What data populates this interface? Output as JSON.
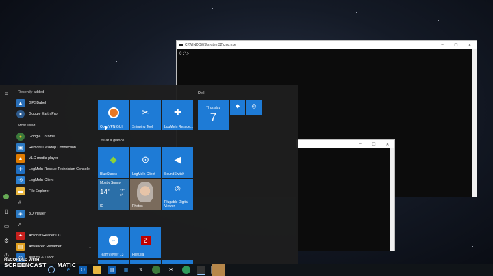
{
  "cmd_main": {
    "title": "C:\\WINDOWS\\system32\\cmd.exe",
    "prompt": "C:\\>"
  },
  "cmd_second": {
    "title": ""
  },
  "start_menu": {
    "sections": {
      "recently_added": "Recently added",
      "most_used": "Most used"
    },
    "recent_apps": [
      {
        "label": "GPSBabel",
        "icon": "gpsbabel-icon",
        "color": "#2a6fb8"
      },
      {
        "label": "Google Earth Pro",
        "icon": "google-earth-icon",
        "color": "#2d5a8c"
      }
    ],
    "most_used": [
      {
        "label": "Google Chrome",
        "icon": "chrome-icon",
        "color": "#3b7a3b"
      },
      {
        "label": "Remote Desktop Connection",
        "icon": "remote-desktop-icon",
        "color": "#2b79c2"
      },
      {
        "label": "VLC media player",
        "icon": "vlc-icon",
        "color": "#e07b00"
      },
      {
        "label": "LogMeIn Rescue Technician Console",
        "icon": "logmein-rescue-icon",
        "color": "#1f6fc2"
      },
      {
        "label": "LogMeIn Client",
        "icon": "logmein-client-icon",
        "color": "#2c7fd0"
      },
      {
        "label": "File Explorer",
        "icon": "file-explorer-icon",
        "color": "#e8b640"
      }
    ],
    "letter_hash": "#",
    "hash_apps": [
      {
        "label": "3D Viewer",
        "icon": "3d-viewer-icon",
        "color": "#2b79c2"
      }
    ],
    "letter_a": "A",
    "a_apps": [
      {
        "label": "Acrobat Reader DC",
        "icon": "acrobat-icon",
        "color": "#c8201d"
      },
      {
        "label": "Advanced Renamer",
        "icon": "advanced-renamer-icon",
        "color": "#e0a020",
        "expand": "⌄"
      },
      {
        "label": "Alarms & Clock",
        "icon": "alarms-clock-icon",
        "color": "#1f6fc2"
      }
    ],
    "tile_groups": {
      "dell": "Dell",
      "life": "Life at a glance"
    },
    "tiles": {
      "openvpn": "OpenVPN GUI",
      "snipping": "Snipping Tool",
      "logmein_rescue": "LogMeIn Rescue...",
      "calendar_day": "Thursday",
      "calendar_num": "7",
      "bluestacks": "BlueStacks",
      "logmein_client": "LogMeIn Client",
      "soundswitch": "SoundSwitch",
      "weather_cond": "Mostly Sunny",
      "weather_temp": "14°",
      "weather_hi": "21°",
      "weather_lo": "6°",
      "weather_loc": "ID",
      "photos": "Photos",
      "plugable": "Plugable Digital Viewer",
      "teamviewer": "TeamViewer 13",
      "filezilla": "FileZilla"
    }
  },
  "watermark": {
    "line1": "RECORDED WITH",
    "line2": "SCREENCAST",
    "line3": "MATIC"
  },
  "taskbar": {
    "icons": [
      "ie-icon",
      "outlook-icon",
      "file-explorer-icon",
      "paint-icon",
      "chrome-icon",
      "snipping-icon",
      "maps-icon",
      "cmd-icon",
      "window-icon",
      "app-icon"
    ]
  }
}
